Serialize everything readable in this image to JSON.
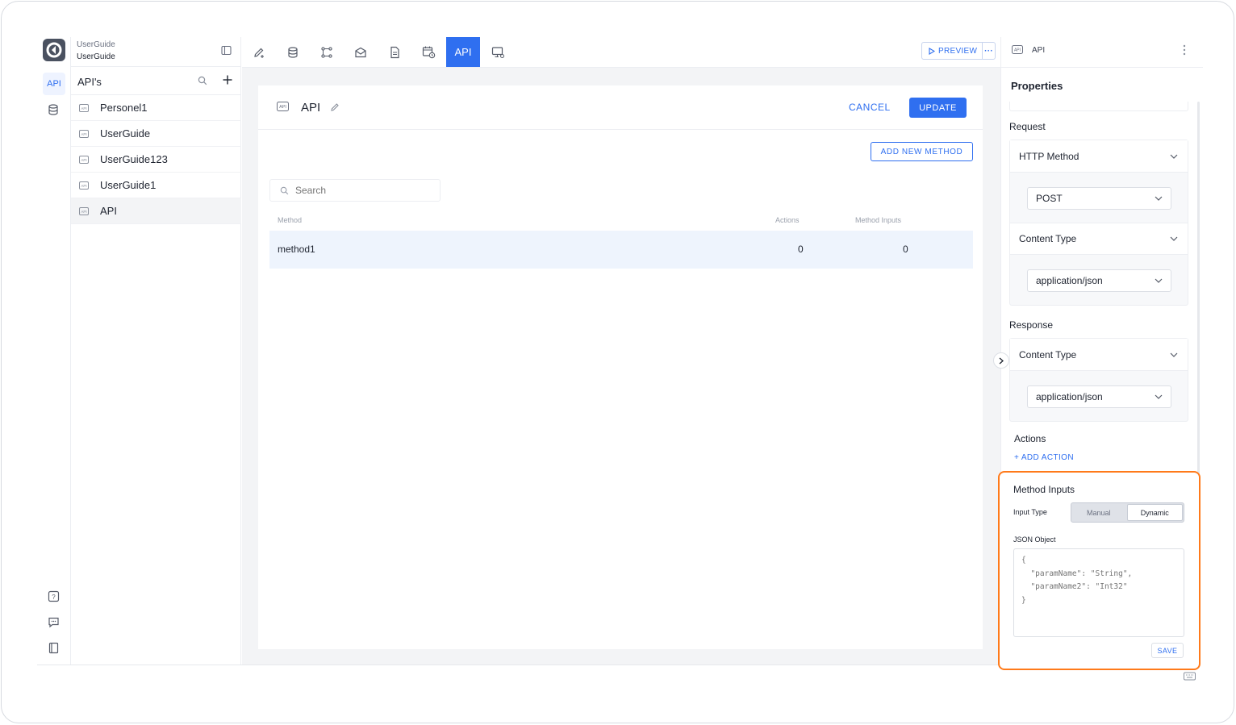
{
  "app": {
    "org_name": "UserGuide",
    "project_name": "UserGuide"
  },
  "rail": {
    "api_label": "API"
  },
  "explorer": {
    "title": "API's",
    "items": [
      {
        "label": "Personel1"
      },
      {
        "label": "UserGuide"
      },
      {
        "label": "UserGuide123"
      },
      {
        "label": "UserGuide1"
      },
      {
        "label": "API",
        "active": true
      }
    ]
  },
  "toolbar": {
    "active_tab_label": "API",
    "preview_label": "PREVIEW",
    "more_label": "···"
  },
  "editor": {
    "title": "API",
    "cancel_label": "CANCEL",
    "update_label": "UPDATE",
    "add_method_label": "ADD NEW METHOD",
    "search_placeholder": "Search",
    "columns": [
      "Method",
      "Actions",
      "Method Inputs"
    ],
    "rows": [
      {
        "method": "method1",
        "actions": "0",
        "method_inputs": "0"
      }
    ]
  },
  "properties": {
    "header_label": "API",
    "title": "Properties",
    "request": {
      "label": "Request",
      "http_method": {
        "label": "HTTP Method",
        "value": "POST"
      },
      "content_type": {
        "label": "Content Type",
        "value": "application/json"
      }
    },
    "response": {
      "label": "Response",
      "content_type": {
        "label": "Content Type",
        "value": "application/json"
      }
    },
    "actions": {
      "label": "Actions",
      "add_label": "+ ADD ACTION"
    },
    "method_inputs": {
      "title": "Method Inputs",
      "input_type_label": "Input Type",
      "options": [
        "Manual",
        "Dynamic"
      ],
      "selected": "Dynamic",
      "json_label": "JSON Object",
      "json_placeholder": "{\n  \"paramName\": \"String\",\n  \"paramName2\": \"Int32\"\n}",
      "save_label": "SAVE"
    }
  },
  "colors": {
    "accent": "#2f6ff0",
    "highlight": "#ff7a1a",
    "row_selected": "#eef4fd"
  }
}
